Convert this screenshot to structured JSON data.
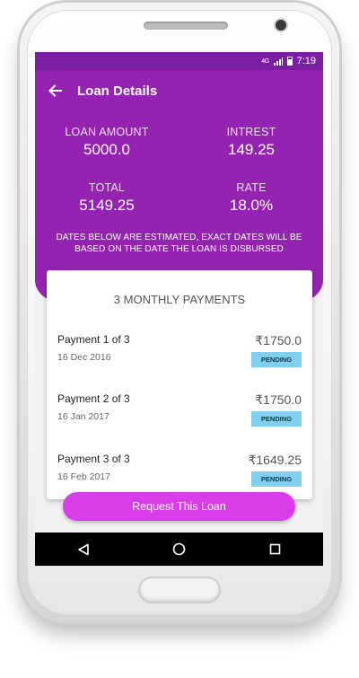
{
  "status_bar": {
    "network": "4G",
    "time": "7:19"
  },
  "app_bar": {
    "title": "Loan Details",
    "back_icon": "arrow-back-icon"
  },
  "summary": {
    "loan_amount": {
      "label": "LOAN AMOUNT",
      "value": "5000.0"
    },
    "interest": {
      "label": "INTREST",
      "value": "149.25"
    },
    "total": {
      "label": "TOTAL",
      "value": "5149.25"
    },
    "rate": {
      "label": "RATE",
      "value": "18.0%"
    }
  },
  "notice": "DATES BELOW ARE ESTIMATED, EXACT DATES WILL BE BASED ON THE DATE THE LOAN IS DISBURSED",
  "payments_card": {
    "title": "3 MONTHLY PAYMENTS",
    "payments": [
      {
        "name": "Payment 1 of 3",
        "date": "16 Dec 2016",
        "amount": "₹1750.0",
        "status": "PENDING"
      },
      {
        "name": "Payment 2 of 3",
        "date": "16 Jan 2017",
        "amount": "₹1750.0",
        "status": "PENDING"
      },
      {
        "name": "Payment 3 of 3",
        "date": "16 Feb 2017",
        "amount": "₹1649.25",
        "status": "PENDING"
      }
    ]
  },
  "cta": {
    "label": "Request This Loan"
  },
  "nav_bar": {
    "icons": [
      "back-triangle-icon",
      "home-circle-icon",
      "recents-square-icon"
    ]
  },
  "colors": {
    "header": "#9423b1",
    "status_bar": "#7b1fa2",
    "cta": "#d93de9",
    "pending_badge": "#7fd0ef"
  }
}
